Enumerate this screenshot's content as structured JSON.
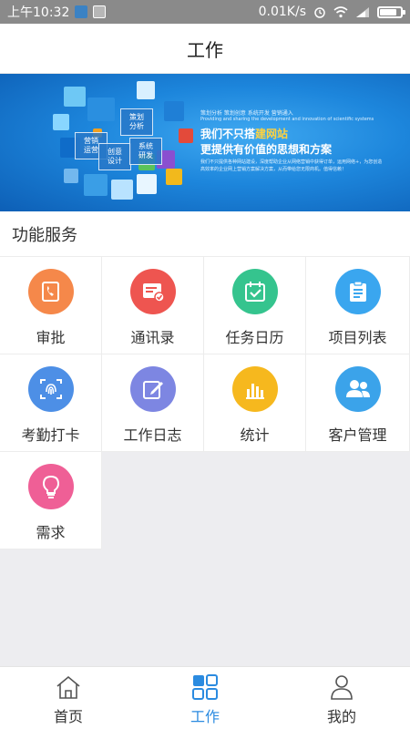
{
  "status_bar": {
    "time": "上午10:32",
    "network_speed": "0.01K/s",
    "icons": [
      "alarm-icon",
      "wifi-icon",
      "signal-icon",
      "battery-icon"
    ],
    "battery_level": 0.85
  },
  "header": {
    "title": "工作"
  },
  "banner": {
    "tiles": [
      "策划\n分析",
      "营销\n运营",
      "创意\n设计",
      "系统\n研发"
    ],
    "top_line": "策划分析  策划创意  系统开发  营销通入",
    "sub_line": "Providing and sharing the development and innovation of scientific systems",
    "headline_1a": "我们不只搭",
    "headline_1b": "建网站",
    "headline_2": "更提供有价值的思想和方案",
    "body_1": "我们不只提供各种网站建设，深度帮助企业从网络营销中获得订单，运用网络+，为您创造",
    "body_2": "高效率的企业网上营销方案解决方案，从而带给您无限商机。值得信赖！"
  },
  "section": {
    "title": "功能服务"
  },
  "services": [
    {
      "label": "审批",
      "icon": "phone-book-icon",
      "color": "#f5884a"
    },
    {
      "label": "通讯录",
      "icon": "contact-card-icon",
      "color": "#ee5550"
    },
    {
      "label": "任务日历",
      "icon": "calendar-check-icon",
      "color": "#35c48e"
    },
    {
      "label": "项目列表",
      "icon": "clipboard-list-icon",
      "color": "#3aa6ef"
    },
    {
      "label": "考勤打卡",
      "icon": "fingerprint-icon",
      "color": "#4d8fe6"
    },
    {
      "label": "工作日志",
      "icon": "edit-note-icon",
      "color": "#7d86e2"
    },
    {
      "label": "统计",
      "icon": "bar-chart-icon",
      "color": "#f6b81e"
    },
    {
      "label": "客户管理",
      "icon": "users-icon",
      "color": "#3ba3ea"
    },
    {
      "label": "需求",
      "icon": "lightbulb-icon",
      "color": "#ef5f96"
    }
  ],
  "tabbar": {
    "tabs": [
      {
        "label": "首页",
        "icon": "home-icon",
        "active": false
      },
      {
        "label": "工作",
        "icon": "grid-icon",
        "active": true
      },
      {
        "label": "我的",
        "icon": "user-icon",
        "active": false
      }
    ],
    "active_color": "#2b8be0"
  }
}
